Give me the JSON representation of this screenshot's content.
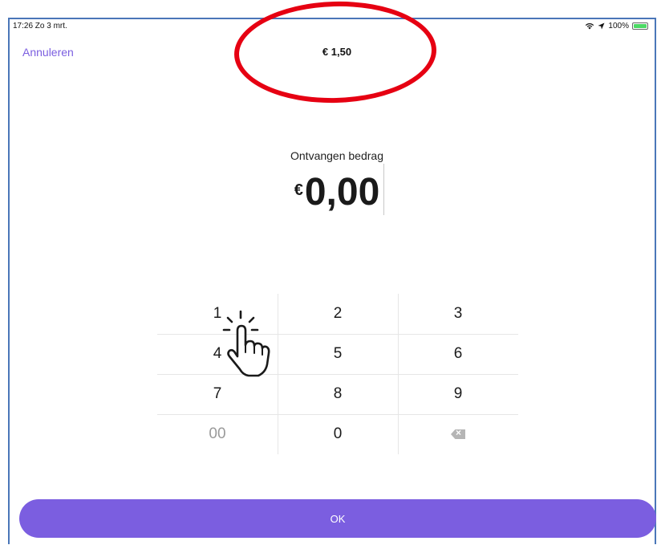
{
  "status_bar": {
    "time": "17:26  Zo 3 mrt.",
    "battery": "100%",
    "battery_level": 1.0
  },
  "nav": {
    "cancel_label": "Annuleren",
    "amount_due": "€ 1,50"
  },
  "received": {
    "label": "Ontvangen bedrag",
    "currency": "€",
    "value": "0,00"
  },
  "keypad": {
    "keys": [
      "1",
      "2",
      "3",
      "4",
      "5",
      "6",
      "7",
      "8",
      "9",
      "00",
      "0"
    ],
    "backspace_icon": "backspace-icon"
  },
  "ok_button": {
    "label": "OK"
  },
  "colors": {
    "accent": "#7b5ee0",
    "highlight": "#e60012"
  }
}
